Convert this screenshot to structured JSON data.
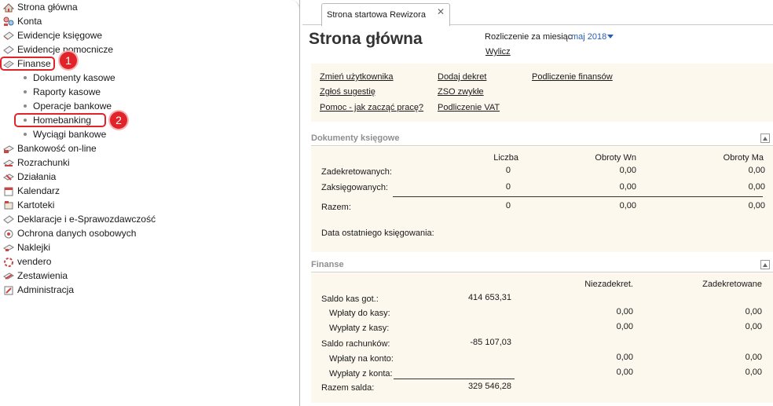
{
  "sidebar": {
    "items": [
      {
        "label": "Strona główna",
        "icon": "home-icon"
      },
      {
        "label": "Konta",
        "icon": "accounts-icon"
      },
      {
        "label": "Ewidencje księgowe",
        "icon": "ledger-icon"
      },
      {
        "label": "Ewidencje pomocnicze",
        "icon": "aux-ledger-icon"
      },
      {
        "label": "Finanse",
        "icon": "finance-icon"
      },
      {
        "label": "Bankowość on-line",
        "icon": "bank-icon"
      },
      {
        "label": "Rozrachunki",
        "icon": "settlements-icon"
      },
      {
        "label": "Działania",
        "icon": "actions-icon"
      },
      {
        "label": "Kalendarz",
        "icon": "calendar-icon"
      },
      {
        "label": "Kartoteki",
        "icon": "files-icon"
      },
      {
        "label": "Deklaracje i e-Sprawozdawczość",
        "icon": "declarations-icon"
      },
      {
        "label": "Ochrona danych osobowych",
        "icon": "privacy-icon"
      },
      {
        "label": "Naklejki",
        "icon": "labels-icon"
      },
      {
        "label": "vendero",
        "icon": "vendero-icon"
      },
      {
        "label": "Zestawienia",
        "icon": "reports-icon"
      },
      {
        "label": "Administracja",
        "icon": "admin-icon"
      }
    ],
    "finanse_children": [
      {
        "label": "Dokumenty kasowe"
      },
      {
        "label": "Raporty kasowe"
      },
      {
        "label": "Operacje bankowe"
      },
      {
        "label": "Homebanking"
      },
      {
        "label": "Wyciągi bankowe"
      }
    ],
    "callouts": [
      "1",
      "2"
    ]
  },
  "tab": {
    "label": "Strona startowa Rewizora",
    "close": "✕"
  },
  "header": {
    "title": "Strona główna",
    "period_label": "Rozliczenie za miesiąc",
    "period_value": "maj 2018",
    "compute": "Wylicz"
  },
  "links": [
    "Zmień użytkownika",
    "Dodaj dekret",
    "Podliczenie finansów",
    "Zgłoś sugestię",
    "ZSO zwykłe",
    "Pomoc - jak zacząć pracę?",
    "Podliczenie VAT"
  ],
  "dokumenty": {
    "title": "Dokumenty księgowe",
    "columns": [
      "Liczba",
      "Obroty Wn",
      "Obroty Ma"
    ],
    "rows": [
      {
        "label": "Zadekretowanych:",
        "v": [
          "0",
          "0,00",
          "0,00"
        ]
      },
      {
        "label": "Zaksięgowanych:",
        "v": [
          "0",
          "0,00",
          "0,00"
        ]
      },
      {
        "label": "Razem:",
        "v": [
          "0",
          "0,00",
          "0,00"
        ]
      }
    ],
    "last_booking": "Data ostatniego księgowania:"
  },
  "finanse": {
    "title": "Finanse",
    "columns": [
      "Niezadekret.",
      "Zadekretowane"
    ],
    "rows": [
      {
        "label": "Saldo kas got.:",
        "amount": "414 653,31",
        "a": "",
        "b": ""
      },
      {
        "label": "Wpłaty do kasy:",
        "amount": "",
        "a": "0,00",
        "b": "0,00"
      },
      {
        "label": "Wypłaty z kasy:",
        "amount": "",
        "a": "0,00",
        "b": "0,00"
      },
      {
        "label": "Saldo rachunków:",
        "amount": "-85 107,03",
        "a": "",
        "b": ""
      },
      {
        "label": "Wpłaty na konto:",
        "amount": "",
        "a": "0,00",
        "b": "0,00"
      },
      {
        "label": "Wypłaty z konta:",
        "amount": "",
        "a": "0,00",
        "b": "0,00"
      },
      {
        "label": "Razem salda:",
        "amount": "329 546,28",
        "a": "",
        "b": ""
      }
    ]
  },
  "colors": {
    "accent": "#e0242a",
    "link": "#2a5db0",
    "panel": "#fcf8ee"
  }
}
